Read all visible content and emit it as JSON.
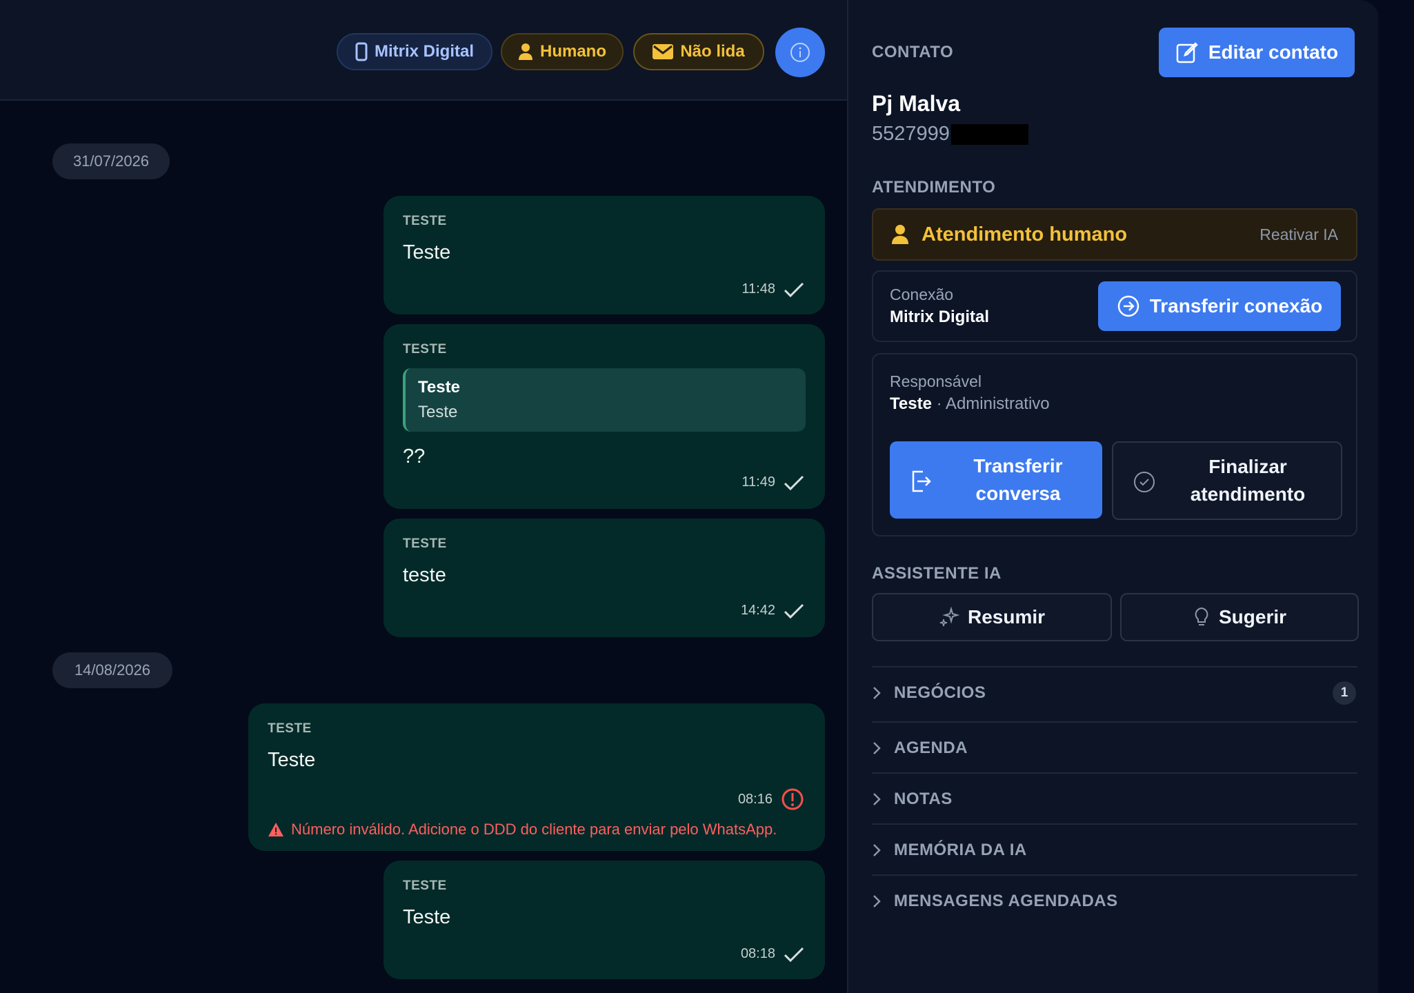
{
  "header": {
    "connection_pill": "Mitrix Digital",
    "mode_pill": "Humano",
    "read_pill": "Não lida"
  },
  "chat": {
    "dates": [
      "31/07/2026",
      "14/08/2026"
    ],
    "messages": [
      {
        "sender": "TESTE",
        "text": "Teste",
        "time": "11:48"
      },
      {
        "sender": "TESTE",
        "quote_author": "Teste",
        "quote_text": "Teste",
        "text": "??",
        "time": "11:49"
      },
      {
        "sender": "TESTE",
        "text": "teste",
        "time": "14:42"
      },
      {
        "sender": "TESTE",
        "text": "Teste",
        "time": "08:16",
        "error": "Número inválido. Adicione o DDD do cliente para enviar pelo WhatsApp."
      },
      {
        "sender": "TESTE",
        "text": "Teste",
        "time": "08:18"
      }
    ]
  },
  "panel": {
    "contact_title": "CONTATO",
    "edit_label": "Editar contato",
    "contact_name": "Pj Malva",
    "contact_phone": "5527999",
    "service_title": "ATENDIMENTO",
    "human_label": "Atendimento humano",
    "reactivate_label": "Reativar IA",
    "connection_label": "Conexão",
    "connection_value": "Mitrix Digital",
    "transfer_connection_label": "Transferir conexão",
    "responsible_label": "Responsável",
    "responsible_name": "Teste",
    "responsible_dept": "· Administrativo",
    "transfer_conversation_label": "Transferir conversa",
    "finish_label": "Finalizar atendimento",
    "assistant_title": "ASSISTENTE IA",
    "summarize_label": "Resumir",
    "suggest_label": "Sugerir",
    "sections": [
      {
        "label": "NEGÓCIOS",
        "badge": "1"
      },
      {
        "label": "AGENDA"
      },
      {
        "label": "NOTAS"
      },
      {
        "label": "MEMÓRIA DA IA"
      },
      {
        "label": "MENSAGENS AGENDADAS"
      }
    ]
  },
  "colors": {
    "accent": "#3d7af0",
    "warning": "#f3c13a",
    "bubble": "#032a28",
    "error": "#ff5f5f"
  }
}
